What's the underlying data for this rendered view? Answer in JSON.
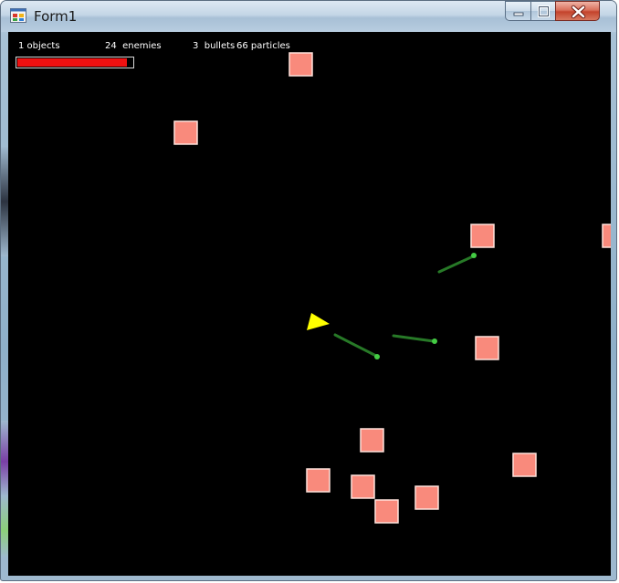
{
  "window": {
    "title": "Form1",
    "controls": [
      "minimize-icon",
      "maximize-icon",
      "close-icon"
    ]
  },
  "hud": {
    "objects": "1 objects",
    "enemies": "24  enemies",
    "bullets": "3  bullets",
    "particles": "66 particles",
    "health_fraction": 0.95
  },
  "colors": {
    "background": "#000000",
    "enemy_fill": "#f98a7c",
    "enemy_border": "#ffe2dc",
    "player": "#ffff00",
    "bullet_head": "#44cc44",
    "health": "#ee1111"
  }
}
